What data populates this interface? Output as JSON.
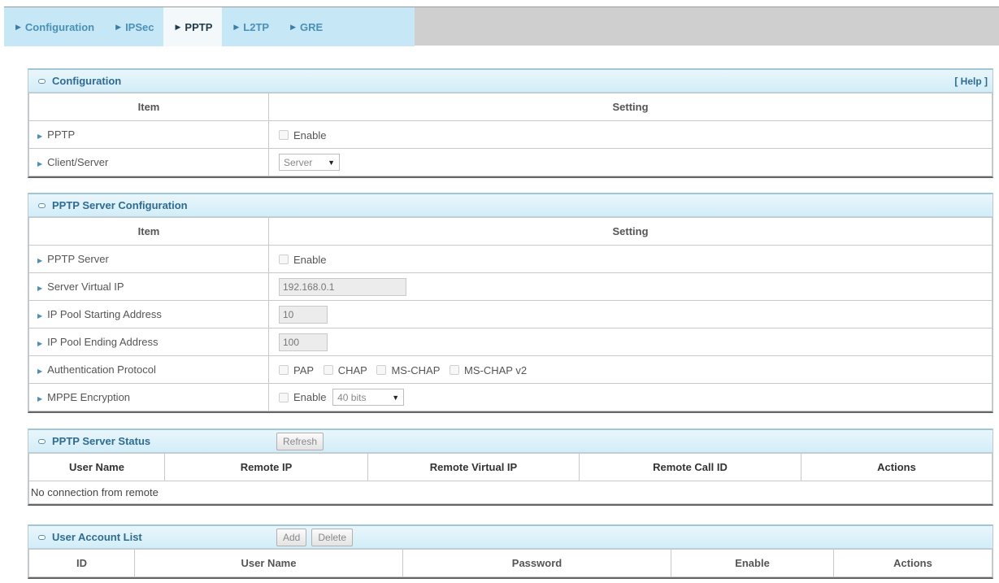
{
  "tabs": [
    {
      "label": "Configuration",
      "active": false
    },
    {
      "label": "IPSec",
      "active": false
    },
    {
      "label": "PPTP",
      "active": true
    },
    {
      "label": "L2TP",
      "active": false
    },
    {
      "label": "GRE",
      "active": false
    }
  ],
  "config": {
    "title": "Configuration",
    "help": "[ Help ]",
    "col_item": "Item",
    "col_setting": "Setting",
    "pptp_label": "PPTP",
    "pptp_enable": "Enable",
    "client_server_label": "Client/Server",
    "client_server_value": "Server"
  },
  "server_config": {
    "title": "PPTP Server Configuration",
    "col_item": "Item",
    "col_setting": "Setting",
    "pptp_server_label": "PPTP Server",
    "pptp_server_enable": "Enable",
    "virtual_ip_label": "Server Virtual IP",
    "virtual_ip_value": "192.168.0.1",
    "pool_start_label": "IP Pool Starting Address",
    "pool_start_value": "10",
    "pool_end_label": "IP Pool Ending Address",
    "pool_end_value": "100",
    "auth_label": "Authentication Protocol",
    "auth_options": [
      "PAP",
      "CHAP",
      "MS-CHAP",
      "MS-CHAP v2"
    ],
    "mppe_label": "MPPE Encryption",
    "mppe_enable": "Enable",
    "mppe_bits": "40 bits"
  },
  "status": {
    "title": "PPTP Server Status",
    "refresh_label": "Refresh",
    "columns": [
      "User Name",
      "Remote IP",
      "Remote Virtual IP",
      "Remote Call ID",
      "Actions"
    ],
    "empty_message": "No connection from remote"
  },
  "accounts": {
    "title": "User Account List",
    "add_label": "Add",
    "delete_label": "Delete",
    "columns": [
      "ID",
      "User Name",
      "Password",
      "Enable",
      "Actions"
    ]
  }
}
